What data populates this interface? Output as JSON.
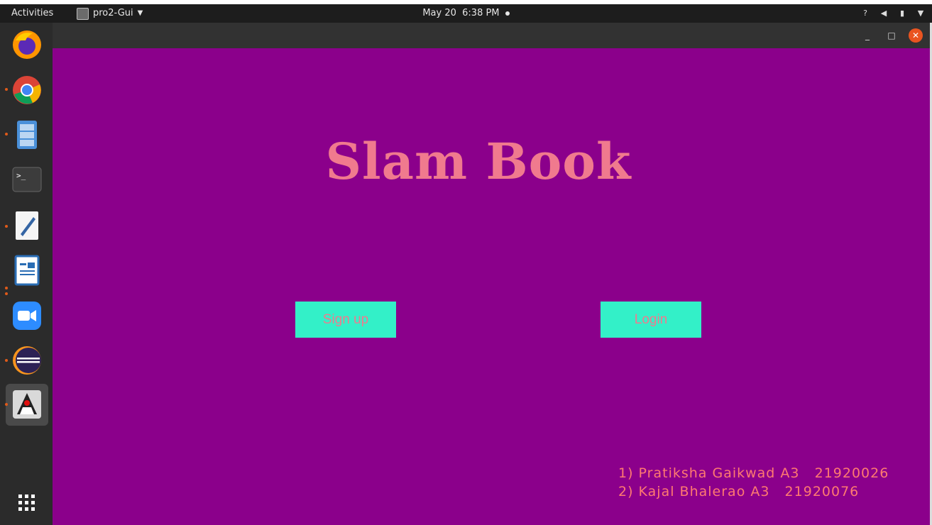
{
  "topbar": {
    "activities": "Activities",
    "app_name": "pro2-Gui",
    "date": "May 20",
    "time": "6:38 PM"
  },
  "dock": {
    "apps": [
      "firefox-icon",
      "chrome-icon",
      "file-manager-icon",
      "terminal-icon",
      "text-editor-icon",
      "libreoffice-writer-icon",
      "zoom-icon",
      "eclipse-icon",
      "java-duke-icon",
      "show-applications-icon"
    ]
  },
  "window": {
    "title": "Slam Book",
    "signup_label": "Sign up",
    "login_label": "Login",
    "credits": [
      "1) Pratiksha Gaikwad A3   21920026",
      "2) Kajal Bhalerao A3   21920076"
    ],
    "colors": {
      "background": "#8b008b",
      "title": "#f07a8e",
      "button": "#33f0c8",
      "credits": "#ff7a70"
    }
  }
}
